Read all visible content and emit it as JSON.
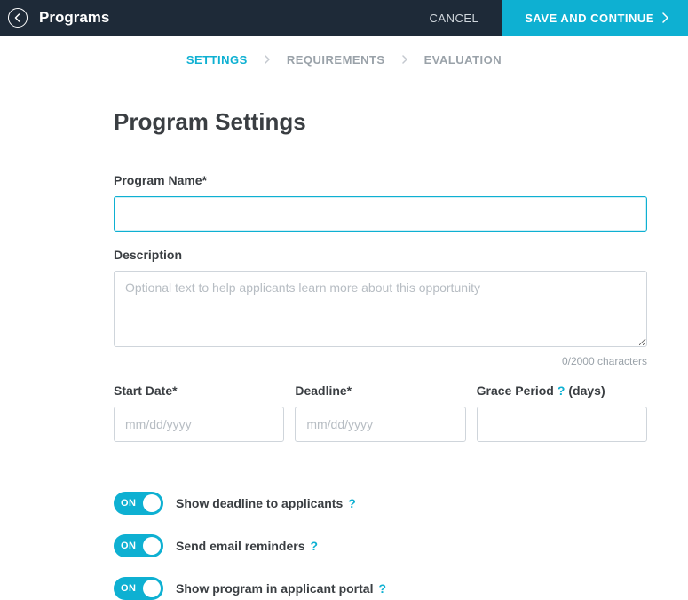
{
  "topbar": {
    "title": "Programs",
    "cancel": "CANCEL",
    "save": "SAVE AND CONTINUE"
  },
  "breadcrumb": {
    "steps": [
      "SETTINGS",
      "REQUIREMENTS",
      "EVALUATION"
    ],
    "active_index": 0
  },
  "page": {
    "heading": "Program Settings",
    "program_name": {
      "label": "Program Name*",
      "value": ""
    },
    "description": {
      "label": "Description",
      "placeholder": "Optional text to help applicants learn more about this opportunity",
      "value": "",
      "counter": "0/2000 characters"
    },
    "start_date": {
      "label": "Start Date*",
      "placeholder": "mm/dd/yyyy",
      "value": ""
    },
    "deadline": {
      "label": "Deadline*",
      "placeholder": "mm/dd/yyyy",
      "value": ""
    },
    "grace_period": {
      "label": "Grace Period",
      "suffix": "(days)",
      "value": ""
    },
    "toggles": [
      {
        "state": "ON",
        "label": "Show deadline to applicants"
      },
      {
        "state": "ON",
        "label": "Send email reminders"
      },
      {
        "state": "ON",
        "label": "Show program in applicant portal"
      }
    ]
  }
}
